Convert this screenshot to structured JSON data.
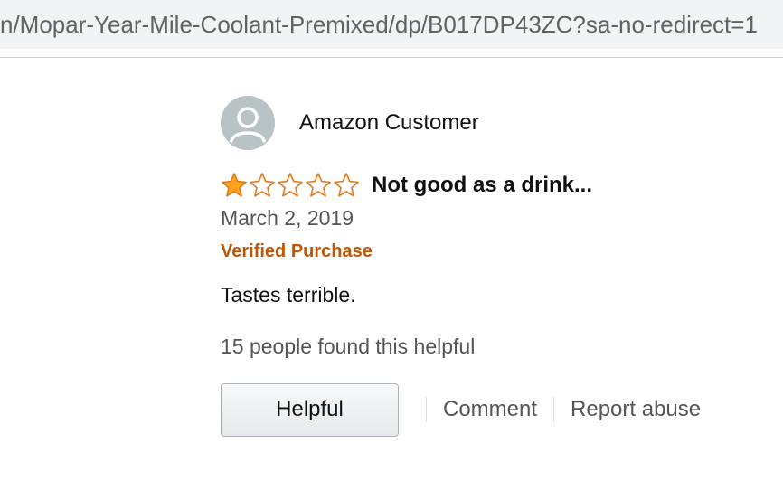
{
  "browser": {
    "url": "n/Mopar-Year-Mile-Coolant-Premixed/dp/B017DP43ZC?sa-no-redirect=1"
  },
  "review": {
    "author": "Amazon Customer",
    "rating": 1,
    "max_rating": 5,
    "title": "Not good as a drink...",
    "date": "March 2, 2019",
    "verified": "Verified Purchase",
    "body": "Tastes terrible.",
    "helpful_count_text": "15 people found this helpful",
    "actions": {
      "helpful": "Helpful",
      "comment": "Comment",
      "report": "Report abuse"
    }
  },
  "colors": {
    "star_filled": "#ffa41c",
    "star_outline": "#de7921",
    "verified": "#c45500",
    "avatar_bg": "#b7c3c4"
  },
  "icons": {
    "avatar": "user-silhouette-icon",
    "star_filled": "star-filled-icon",
    "star_empty": "star-empty-icon"
  }
}
